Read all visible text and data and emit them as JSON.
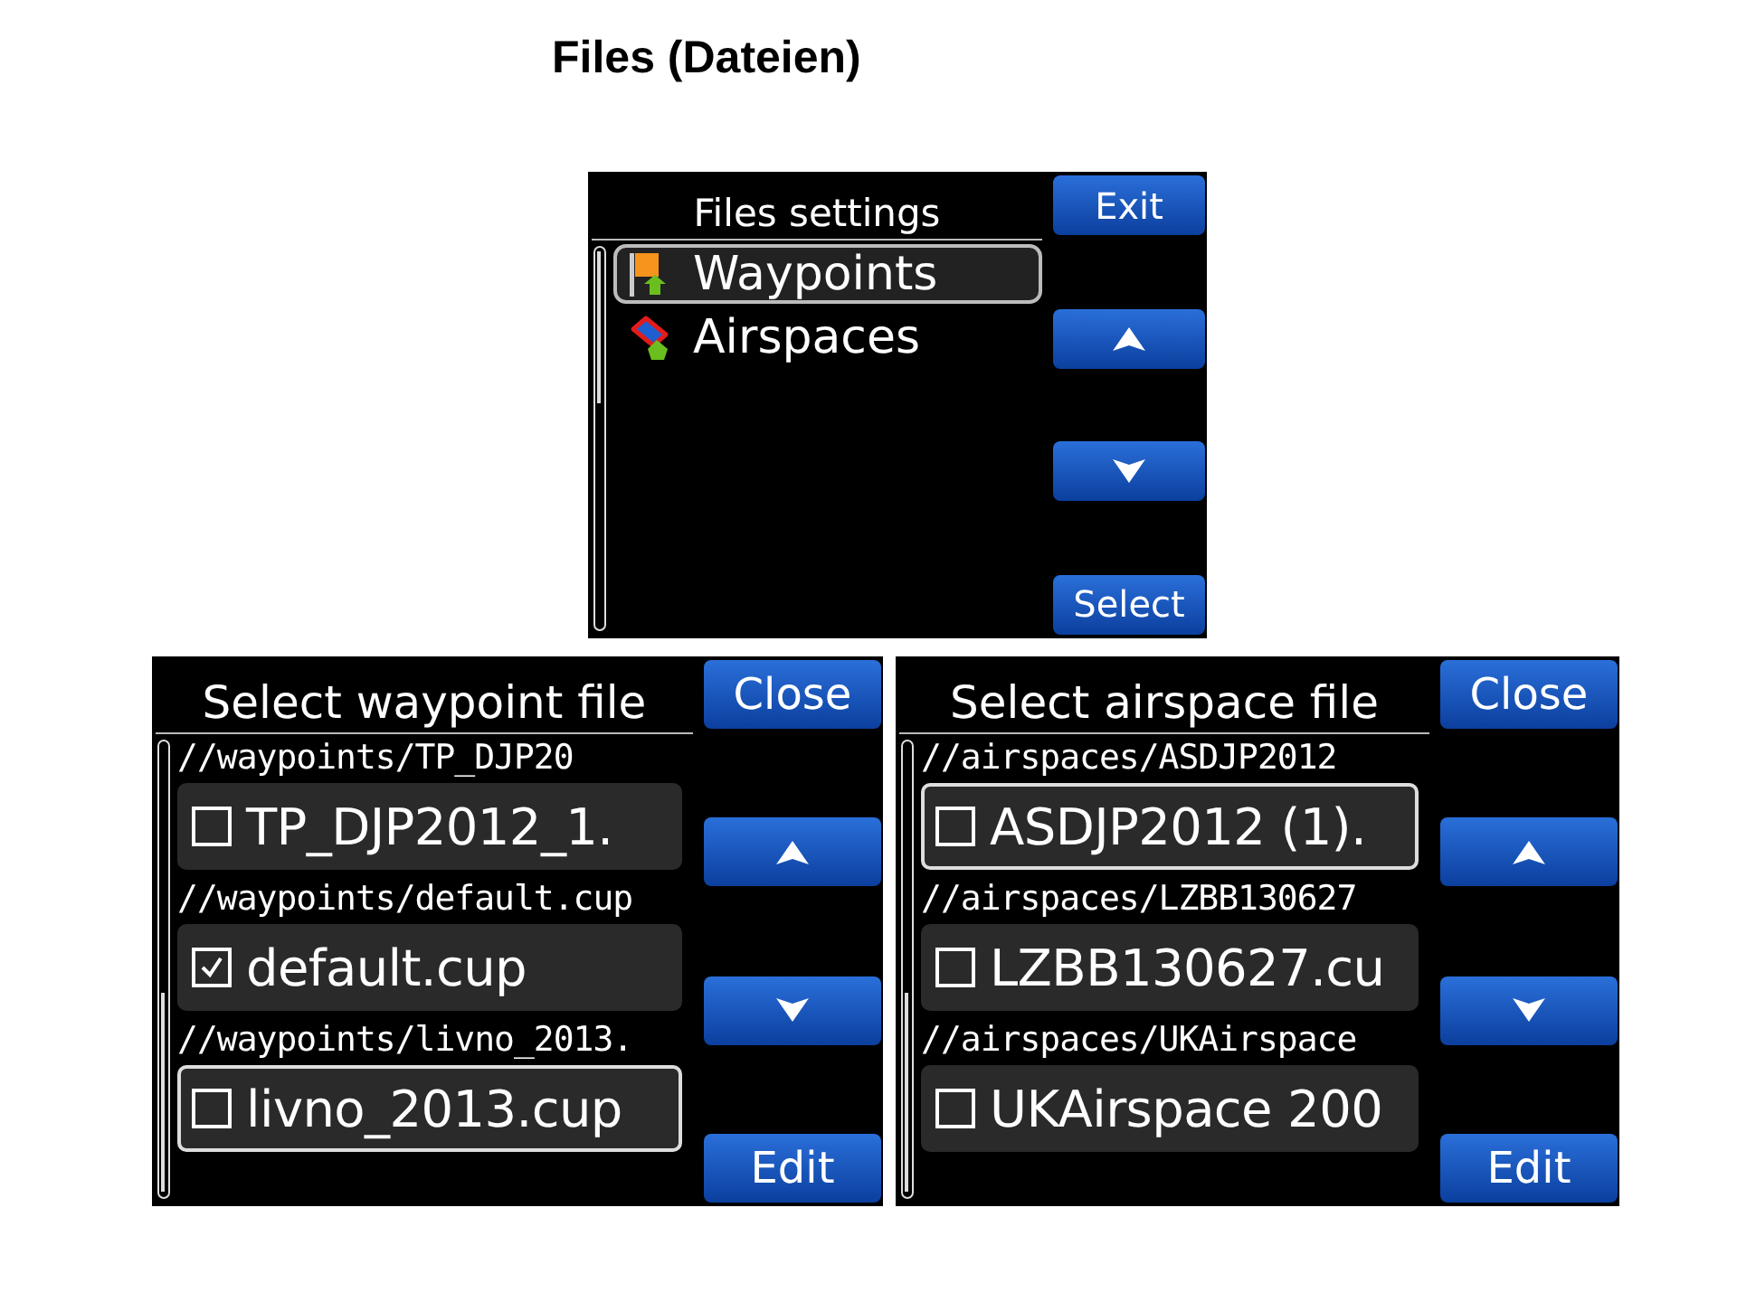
{
  "heading": "Files (Dateien)",
  "screens": [
    {
      "kind": "menu",
      "title": "Files settings",
      "items": [
        {
          "kind": "waypoints",
          "label": "Waypoints",
          "selected": true
        },
        {
          "kind": "airspaces",
          "label": "Airspaces",
          "selected": false
        }
      ],
      "buttons": [
        {
          "kind": "text",
          "label": "Exit"
        },
        {
          "kind": "up"
        },
        {
          "kind": "down"
        },
        {
          "kind": "text",
          "label": "Select"
        }
      ]
    },
    {
      "kind": "files",
      "title": "Select waypoint file",
      "items": [
        {
          "path": "//waypoints/TP_DJP20",
          "label": "TP_DJP2012_1.",
          "checked": false,
          "selected": false
        },
        {
          "path": "//waypoints/default.cup",
          "label": "default.cup",
          "checked": true,
          "selected": false
        },
        {
          "path": "//waypoints/livno_2013.",
          "label": "livno_2013.cup",
          "checked": false,
          "selected": true
        }
      ],
      "buttons": [
        {
          "kind": "text",
          "label": "Close"
        },
        {
          "kind": "up"
        },
        {
          "kind": "down"
        },
        {
          "kind": "text",
          "label": "Edit"
        }
      ]
    },
    {
      "kind": "files",
      "title": "Select airspace file",
      "items": [
        {
          "path": "//airspaces/ASDJP2012",
          "label": "ASDJP2012 (1).",
          "checked": false,
          "selected": true
        },
        {
          "path": "//airspaces/LZBB130627",
          "label": "LZBB130627.cu",
          "checked": false,
          "selected": false
        },
        {
          "path": "//airspaces/UKAirspace",
          "label": "UKAirspace 200",
          "checked": false,
          "selected": false
        }
      ],
      "buttons": [
        {
          "kind": "text",
          "label": "Close"
        },
        {
          "kind": "up"
        },
        {
          "kind": "down"
        },
        {
          "kind": "text",
          "label": "Edit"
        }
      ]
    }
  ]
}
